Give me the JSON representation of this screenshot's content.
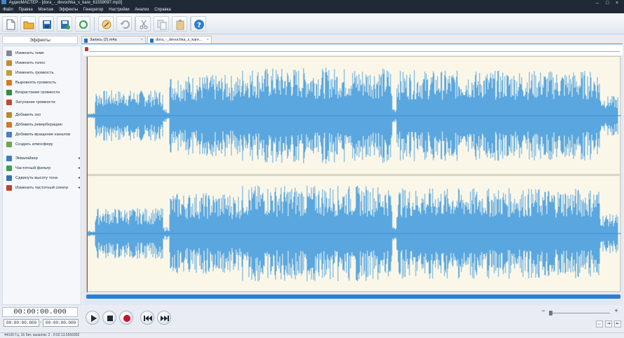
{
  "window": {
    "title": "АудиоМАСТЕР - [dora_-_devochka_s_kare_61559097.mp3]",
    "controls": [
      "–",
      "□",
      "×"
    ]
  },
  "menu": [
    "Файл",
    "Правка",
    "Монтаж",
    "Эффекты",
    "Генератор",
    "Настройки",
    "Анализ",
    "Справка"
  ],
  "toolbar": {
    "icons": [
      "new-file",
      "open-folder",
      "save",
      "save-as",
      "refresh",
      "edit-audio",
      "undo",
      "cut",
      "copy",
      "paste",
      "help"
    ]
  },
  "effects_panel": {
    "header": "Эффекты",
    "items": [
      {
        "label": "Изменить темп",
        "icon": "tempo",
        "color": "#7d8a9a"
      },
      {
        "label": "Изменить голос",
        "icon": "voice",
        "color": "#c98a2b"
      },
      {
        "label": "Изменить громкость",
        "icon": "volume",
        "color": "#c89a3a"
      },
      {
        "label": "Выровнять громкость",
        "icon": "normalize",
        "color": "#d97a20"
      },
      {
        "label": "Возрастание громкости",
        "icon": "fade-in",
        "color": "#2f8f3a"
      },
      {
        "label": "Затухание громкости",
        "icon": "fade-out",
        "color": "#c04a2a"
      },
      {
        "label": "Добавить эхо",
        "icon": "echo",
        "color": "#b98a2a"
      },
      {
        "label": "Добавить реверберацию",
        "icon": "reverb",
        "color": "#d07a2a"
      },
      {
        "label": "Добавить вращение каналов",
        "icon": "rotate",
        "color": "#4a7fc0"
      },
      {
        "label": "Создать атмосферу",
        "icon": "atmosphere",
        "color": "#6aa84f"
      },
      {
        "label": "Эквалайзер",
        "icon": "equalizer",
        "color": "#3a7dc0"
      },
      {
        "label": "Частотный фильтр",
        "icon": "filter",
        "color": "#3aa04a"
      },
      {
        "label": "Сдвинуть высоту тона",
        "icon": "pitch",
        "color": "#3a6fb0"
      },
      {
        "label": "Изменить частотный спектр",
        "icon": "spectrum",
        "color": "#c0402a"
      }
    ]
  },
  "tabs": [
    {
      "label": "Запись (2).m4a",
      "active": false
    },
    {
      "label": "dora_-_devochka_s_kare...",
      "active": true
    }
  ],
  "waveform": {
    "fill": "#5aa7e0",
    "background": "#fbf7e8",
    "channels": 2
  },
  "transport": {
    "current_time": "00:00:00.000",
    "selection_start": "00:00:00.000",
    "selection_separator": "-",
    "selection_end": "00:00:00.000",
    "buttons": [
      "play",
      "stop",
      "record",
      "go-to-start",
      "go-to-end"
    ]
  },
  "zoom": {
    "minus": "−",
    "plus": "+",
    "level": 0.0
  },
  "status": "44100 Гц, 16 бит, каналов: 2 · 0:02:13.5556992"
}
